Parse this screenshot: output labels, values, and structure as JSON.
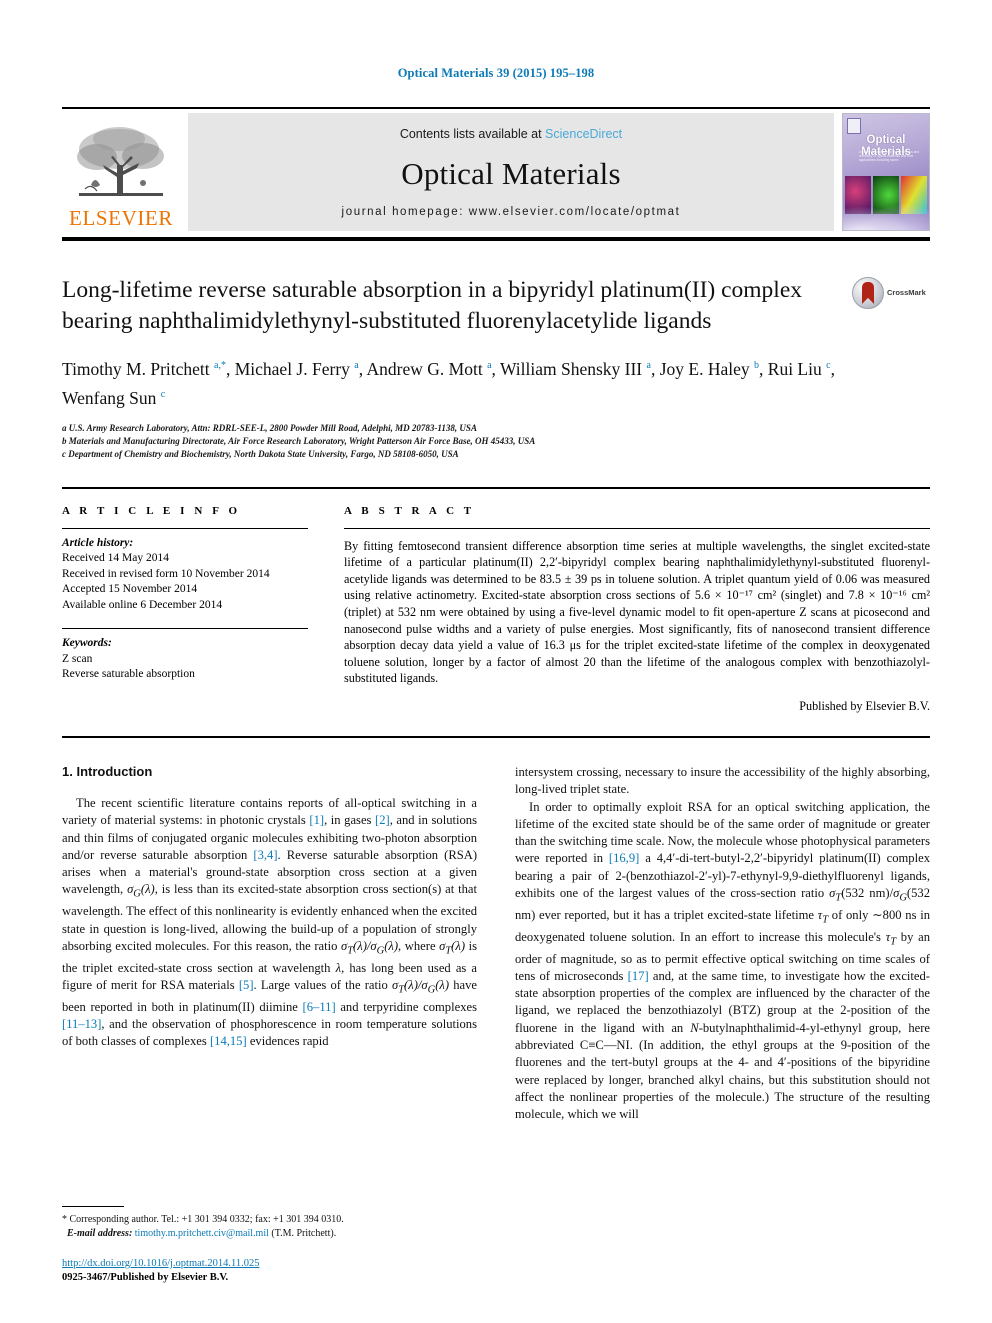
{
  "running_head": "Optical Materials 39 (2015) 195–198",
  "masthead": {
    "contents_prefix": "Contents lists available at ",
    "sciencedirect": "ScienceDirect",
    "journal_name": "Optical Materials",
    "homepage": "journal homepage: www.elsevier.com/locate/optmat",
    "publisher_logo_text": "ELSEVIER",
    "cover_title": "Optical Materials",
    "cover_subtitle": "An international journal on the physics and chemistry of optical materials and their applications including lasers",
    "crossmark_label": "CrossMark"
  },
  "article": {
    "title": "Long-lifetime reverse saturable absorption in a bipyridyl platinum(II) complex bearing naphthalimidylethynyl-substituted fluorenylacetylide ligands",
    "authors_line_1": "Timothy M. Pritchett a,*, Michael J. Ferry a, Andrew G. Mott a, William Shensky III a, Joy E. Haley b, Rui Liu c,",
    "authors_line_2": "Wenfang Sun c",
    "affiliations": [
      "a U.S. Army Research Laboratory, Attn: RDRL-SEE-L, 2800 Powder Mill Road, Adelphi, MD 20783-1138, USA",
      "b Materials and Manufacturing Directorate, Air Force Research Laboratory, Wright Patterson Air Force Base, OH 45433, USA",
      "c Department of Chemistry and Biochemistry, North Dakota State University, Fargo, ND 58108-6050, USA"
    ]
  },
  "article_info": {
    "label": "A R T I C L E   I N F O",
    "history_heading": "Article history:",
    "history": [
      "Received 14 May 2014",
      "Received in revised form 10 November 2014",
      "Accepted 15 November 2014",
      "Available online 6 December 2014"
    ],
    "keywords_heading": "Keywords:",
    "keywords": [
      "Z scan",
      "Reverse saturable absorption"
    ]
  },
  "abstract": {
    "label": "A B S T R A C T",
    "text": "By fitting femtosecond transient difference absorption time series at multiple wavelengths, the singlet excited-state lifetime of a particular platinum(II) 2,2′-bipyridyl complex bearing naphthalimidylethynyl-substituted fluorenyl-acetylide ligands was determined to be 83.5 ± 39 ps in toluene solution. A triplet quantum yield of 0.06 was measured using relative actinometry. Excited-state absorption cross sections of 5.6 × 10⁻¹⁷ cm² (singlet) and 7.8 × 10⁻¹⁶ cm² (triplet) at 532 nm were obtained by using a five-level dynamic model to fit open-aperture Z scans at picosecond and nanosecond pulse widths and a variety of pulse energies. Most significantly, fits of nanosecond transient difference absorption decay data yield a value of 16.3 μs for the triplet excited-state lifetime of the complex in deoxygenated toluene solution, longer by a factor of almost 20 than the lifetime of the analogous complex with benzothiazolyl-substituted ligands.",
    "published_by": "Published by Elsevier B.V."
  },
  "introduction": {
    "heading": "1. Introduction",
    "left_para_1": "The recent scientific literature contains reports of all-optical switching in a variety of material systems: in photonic crystals [1], in gases [2], and in solutions and thin films of conjugated organic molecules exhibiting two-photon absorption and/or reverse saturable absorption [3,4]. Reverse saturable absorption (RSA) arises when a material's ground-state absorption cross section at a given wavelength, σG(λ), is less than its excited-state absorption cross section(s) at that wavelength. The effect of this nonlinearity is evidently enhanced when the excited state in question is long-lived, allowing the build-up of a population of strongly absorbing excited molecules. For this reason, the ratio σT(λ)/σG(λ), where σT(λ) is the triplet excited-state cross section at wavelength λ, has long been used as a figure of merit for RSA materials [5]. Large values of the ratio σT(λ)/σG(λ) have been reported in both in platinum(II) diimine [6–11] and terpyridine complexes [11–13], and the observation of phosphorescence in room temperature solutions of both classes of complexes [14,15] evidences rapid",
    "right_para_1_cont": "intersystem crossing, necessary to insure the accessibility of the highly absorbing, long-lived triplet state.",
    "right_para_2": "In order to optimally exploit RSA for an optical switching application, the lifetime of the excited state should be of the same order of magnitude or greater than the switching time scale. Now, the molecule whose photophysical parameters were reported in [16,9] a 4,4′-di-tert-butyl-2,2′-bipyridyl platinum(II) complex bearing a pair of 2-(benzothiazol-2′-yl)-7-ethynyl-9,9-diethylfluorenyl ligands, exhibits one of the largest values of the cross-section ratio σT(532 nm)/σG(532 nm) ever reported, but it has a triplet excited-state lifetime τT of only ~800 ns in deoxygenated toluene solution. In an effort to increase this molecule's τT by an order of magnitude, so as to permit effective optical switching on time scales of tens of microseconds [17] and, at the same time, to investigate how the excited-state absorption properties of the complex are influenced by the character of the ligand, we replaced the benzothiazolyl (BTZ) group at the 2-position of the fluorene in the ligand with an N-butylnaphthalimid-4-yl-ethynyl group, here abbreviated C≡C—NI. (In addition, the ethyl groups at the 9-position of the fluorenes and the tert-butyl groups at the 4- and 4′-positions of the bipyridine were replaced by longer, branched alkyl chains, but this substitution should not affect the nonlinear properties of the molecule.) The structure of the resulting molecule, which we will"
  },
  "footnote": {
    "corresponding": "* Corresponding author. Tel.: +1 301 394 0332; fax: +1 301 394 0310.",
    "email_label": "E-mail address:",
    "email": "timothy.m.pritchett.civ@mail.mil",
    "email_suffix": "(T.M. Pritchett).",
    "doi": "http://dx.doi.org/10.1016/j.optmat.2014.11.025",
    "issn": "0925-3467/Published by Elsevier B.V."
  },
  "colors": {
    "link": "#0b7ab5",
    "elsevier_orange": "#ec7404",
    "sciencedirect": "#4aa8d8"
  }
}
